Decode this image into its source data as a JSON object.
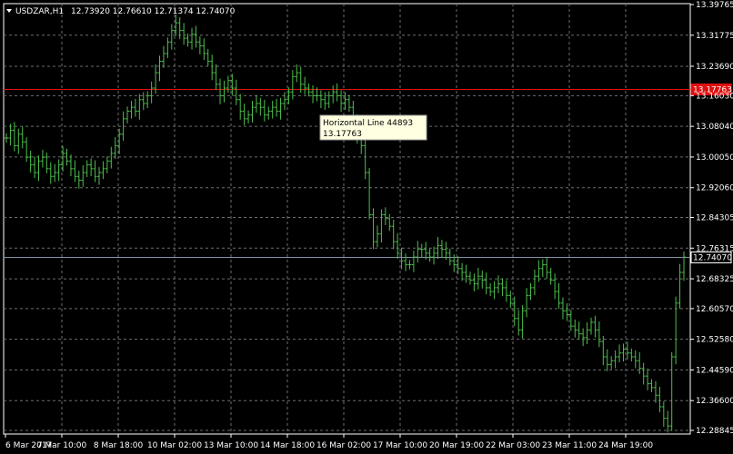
{
  "header": {
    "symbol_timeframe": "USDZAR,H1",
    "ohlc": "12.73920 12.76610 12.71374 12.74070",
    "menu_icon": "triangle-down-icon"
  },
  "chart_data": {
    "type": "bar",
    "title": "",
    "xlabel": "",
    "ylabel": "",
    "ylim": [
      12.279,
      13.4
    ],
    "y_ticks": [
      "13.39765",
      "13.31775",
      "13.23690",
      "13.16030",
      "13.08040",
      "13.00050",
      "12.92060",
      "12.84305",
      "12.76315",
      "12.68325",
      "12.60570",
      "12.52580",
      "12.44590",
      "12.36600",
      "12.28845"
    ],
    "x_ticks": [
      "6 Mar 2017",
      "7 Mar 10:00",
      "8 Mar 18:00",
      "10 Mar 02:00",
      "13 Mar 10:00",
      "14 Mar 18:00",
      "16 Mar 02:00",
      "17 Mar 10:00",
      "20 Mar 19:00",
      "22 Mar 03:00",
      "23 Mar 11:00",
      "24 Mar 19:00"
    ],
    "grid": true,
    "bar_color": "#4cbf4c",
    "series": [
      {
        "values": [
          13.05,
          13.07,
          13.03,
          13.06,
          13.04,
          13.0,
          12.98,
          12.96,
          12.99,
          13.0,
          12.97,
          12.95,
          12.96,
          12.98,
          13.01,
          12.99,
          12.97,
          12.95,
          12.94,
          12.96,
          12.98,
          12.97,
          12.95,
          12.96,
          12.97,
          12.99,
          13.01,
          13.03,
          13.06,
          13.1,
          13.12,
          13.13,
          13.12,
          13.15,
          13.14,
          13.16,
          13.18,
          13.22,
          13.25,
          13.27,
          13.3,
          13.33,
          13.35,
          13.33,
          13.31,
          13.3,
          13.32,
          13.3,
          13.29,
          13.27,
          13.25,
          13.22,
          13.19,
          13.16,
          13.18,
          13.2,
          13.18,
          13.15,
          13.12,
          13.1,
          13.11,
          13.13,
          13.14,
          13.13,
          13.11,
          13.12,
          13.13,
          13.12,
          13.14,
          13.15,
          13.17,
          13.21,
          13.22,
          13.19,
          13.18,
          13.17,
          13.16,
          13.16,
          13.15,
          13.14,
          13.16,
          13.17,
          13.16,
          13.14,
          13.15,
          13.13,
          13.09,
          13.05,
          13.03,
          12.96,
          12.85,
          12.78,
          12.8,
          12.85,
          12.84,
          12.82,
          12.78,
          12.75,
          12.73,
          12.72,
          12.72,
          12.74,
          12.76,
          12.76,
          12.75,
          12.74,
          12.75,
          12.77,
          12.76,
          12.75,
          12.73,
          12.72,
          12.71,
          12.7,
          12.69,
          12.68,
          12.67,
          12.69,
          12.68,
          12.66,
          12.65,
          12.66,
          12.67,
          12.66,
          12.64,
          12.62,
          12.58,
          12.55,
          12.6,
          12.64,
          12.66,
          12.69,
          12.71,
          12.72,
          12.7,
          12.68,
          12.65,
          12.62,
          12.6,
          12.59,
          12.56,
          12.55,
          12.54,
          12.53,
          12.55,
          12.57,
          12.55,
          12.52,
          12.48,
          12.46,
          12.47,
          12.48,
          12.49,
          12.5,
          12.49,
          12.48,
          12.47,
          12.45,
          12.43,
          12.41,
          12.4,
          12.38,
          12.35,
          12.32,
          12.3,
          12.48,
          12.62,
          12.7,
          12.74
        ]
      }
    ],
    "levels": [
      {
        "name": "red-horizontal-line",
        "value": 13.17763,
        "label": "13.17763",
        "color": "#e01010"
      },
      {
        "name": "current-price-line",
        "value": 12.7407,
        "label": "12.74070",
        "color": "#7f8fa6"
      }
    ]
  },
  "tooltip": {
    "line1": "Horizontal Line 44893",
    "line2": "13.17763"
  }
}
